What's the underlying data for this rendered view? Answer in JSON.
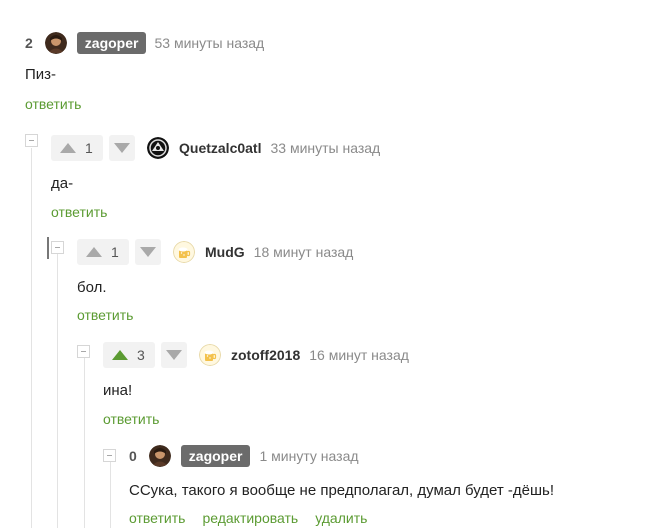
{
  "comments": [
    {
      "rating": "2",
      "author": "zagoper",
      "time": "53 минуты назад",
      "text": "Пиз-",
      "actions": {
        "reply": "ответить"
      }
    },
    {
      "rating": "1",
      "author": "Quetzalc0atl",
      "time": "33 минуты назад",
      "text": "да-",
      "actions": {
        "reply": "ответить"
      }
    },
    {
      "rating": "1",
      "author": "MudG",
      "time": "18 минут назад",
      "text": "бол.",
      "actions": {
        "reply": "ответить"
      }
    },
    {
      "rating": "3",
      "author": "zotoff2018",
      "time": "16 минут назад",
      "text": "ина!",
      "actions": {
        "reply": "ответить"
      },
      "voted_up": true
    },
    {
      "rating": "0",
      "author": "zagoper",
      "time": "1 минуту назад",
      "text": "ССука, такого я вообще не предполагал, думал будет -дёшь!",
      "actions": {
        "reply": "ответить",
        "edit": "редактировать",
        "delete": "удалить"
      }
    }
  ],
  "colors": {
    "link": "#5b9b32",
    "upvote_active": "#5b9b32",
    "arrow_inactive": "#a9a9a9",
    "vote_bg": "#f2f2f2",
    "badge_bg": "#6b6b6b"
  },
  "icons": {
    "upvote": "triangle-up-icon",
    "downvote": "triangle-down-icon",
    "collapse": "minus-box-icon"
  }
}
